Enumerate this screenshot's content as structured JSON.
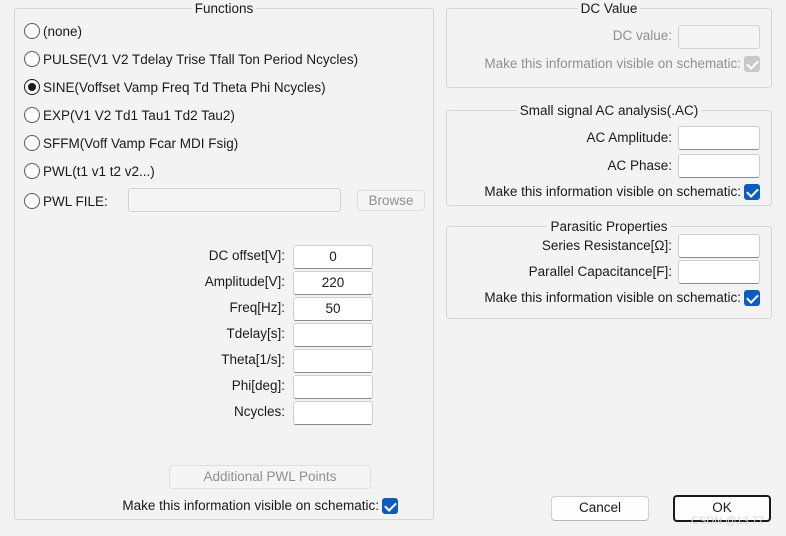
{
  "functions": {
    "title": "Functions",
    "options": [
      {
        "label": "(none)",
        "selected": false
      },
      {
        "label": "PULSE(V1 V2 Tdelay Trise Tfall Ton Period Ncycles)",
        "selected": false
      },
      {
        "label": "SINE(Voffset Vamp Freq Td Theta Phi Ncycles)",
        "selected": true
      },
      {
        "label": "EXP(V1 V2 Td1 Tau1 Td2 Tau2)",
        "selected": false
      },
      {
        "label": "SFFM(Voff Vamp Fcar MDI Fsig)",
        "selected": false
      },
      {
        "label": "PWL(t1 v1 t2 v2...)",
        "selected": false
      },
      {
        "label": "PWL FILE:",
        "selected": false
      }
    ],
    "pwl_file_value": "",
    "browse_label": "Browse",
    "params": [
      {
        "label": "DC offset[V]:",
        "value": "0"
      },
      {
        "label": "Amplitude[V]:",
        "value": "220"
      },
      {
        "label": "Freq[Hz]:",
        "value": "50"
      },
      {
        "label": "Tdelay[s]:",
        "value": ""
      },
      {
        "label": "Theta[1/s]:",
        "value": ""
      },
      {
        "label": "Phi[deg]:",
        "value": ""
      },
      {
        "label": "Ncycles:",
        "value": ""
      }
    ],
    "additional_pwl_label": "Additional PWL Points",
    "visible_label": "Make this information visible on schematic:",
    "visible_checked": true
  },
  "dc_value": {
    "title": "DC Value",
    "label": "DC value:",
    "value": "",
    "visible_label": "Make this information visible on schematic:",
    "visible_checked": true
  },
  "ac_analysis": {
    "title": "Small signal AC analysis(.AC)",
    "amplitude_label": "AC Amplitude:",
    "amplitude_value": "",
    "phase_label": "AC Phase:",
    "phase_value": "",
    "visible_label": "Make this information visible on schematic:",
    "visible_checked": true
  },
  "parasitic": {
    "title": "Parasitic Properties",
    "resistance_label": "Series Resistance[Ω]:",
    "resistance_value": "",
    "capacitance_label": "Parallel Capacitance[F]:",
    "capacitance_value": "",
    "visible_label": "Make this information visible on schematic:",
    "visible_checked": true
  },
  "buttons": {
    "cancel": "Cancel",
    "ok": "OK"
  },
  "watermark": "CSDN @13 77",
  "colors": {
    "background": "#f3f3f3",
    "check_accent": "#0a5cc2"
  }
}
